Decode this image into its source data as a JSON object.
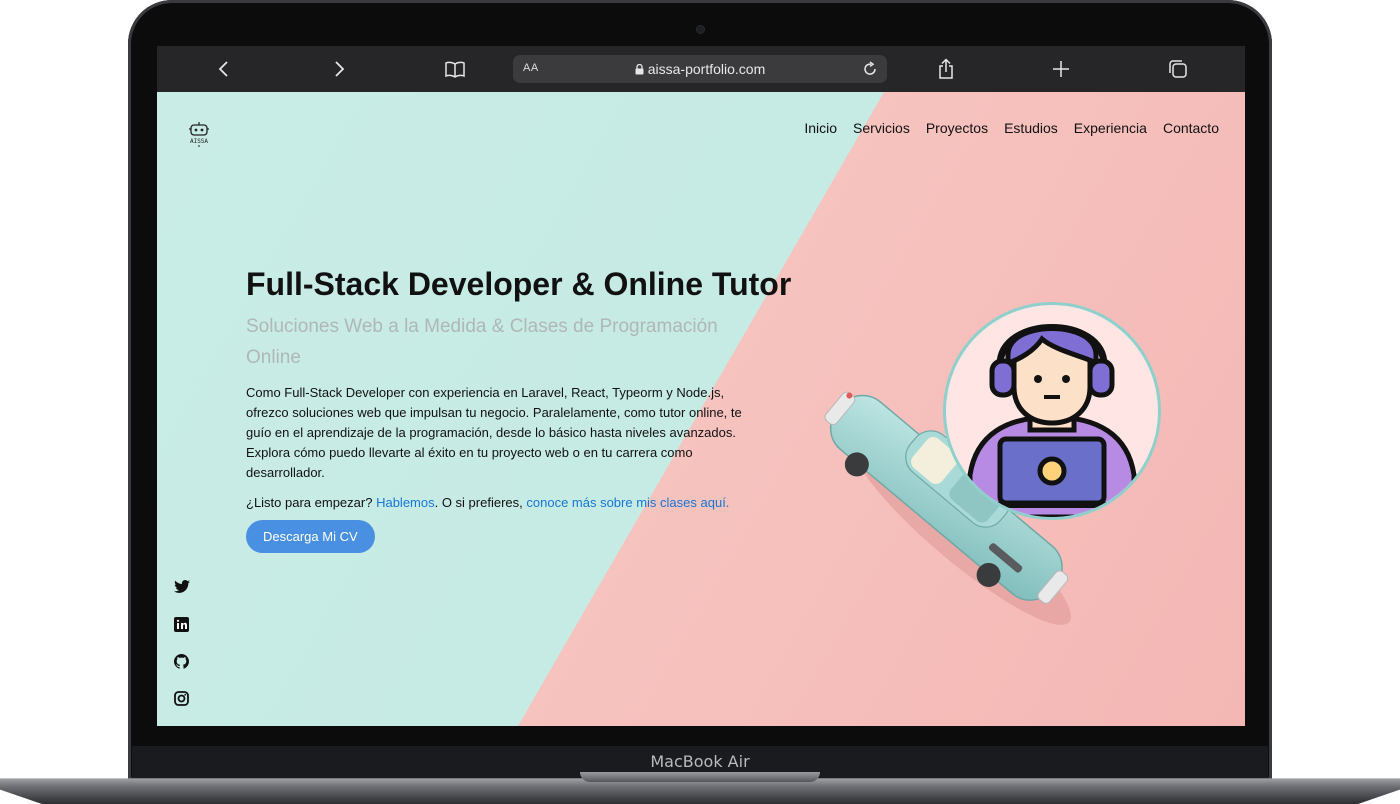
{
  "device": {
    "label": "MacBook Air"
  },
  "browser": {
    "url": "aissa-portfolio.com",
    "text_size_label": "AA",
    "icons": [
      "back-icon",
      "forward-icon",
      "bookmarks-icon",
      "lock-icon",
      "reload-icon",
      "share-icon",
      "new-tab-icon",
      "tabs-icon"
    ]
  },
  "site": {
    "logo_text": "AISSA",
    "nav": [
      "Inicio",
      "Servicios",
      "Proyectos",
      "Estudios",
      "Experiencia",
      "Contacto"
    ],
    "hero": {
      "title": "Full-Stack Developer & Online Tutor",
      "subtitle": "Soluciones Web a la Medida & Clases de Programación Online",
      "description": "Como Full-Stack Developer con experiencia en Laravel, React, Typeorm y Node.js, ofrezco soluciones web que impulsan tu negocio. Paralelamente, como tutor online, te guío en el aprendizaje de la programación, desde lo básico hasta niveles avanzados. Explora cómo puedo llevarte al éxito en tu proyecto web o en tu carrera como desarrollador.",
      "cta_prefix": "¿Listo para empezar?",
      "cta_link1": "Hablemos",
      "cta_middle": ". O si prefieres,",
      "cta_link2": "conoce más sobre mis clases aquí.",
      "cv_button": "Descarga Mi CV"
    },
    "social_icons": [
      "twitter-icon",
      "linkedin-icon",
      "github-icon",
      "instagram-icon"
    ],
    "colors": {
      "mint": "#c8ebe6",
      "pink": "#f4b7b4",
      "accent": "#4a90e2",
      "link": "#1676d6"
    }
  }
}
